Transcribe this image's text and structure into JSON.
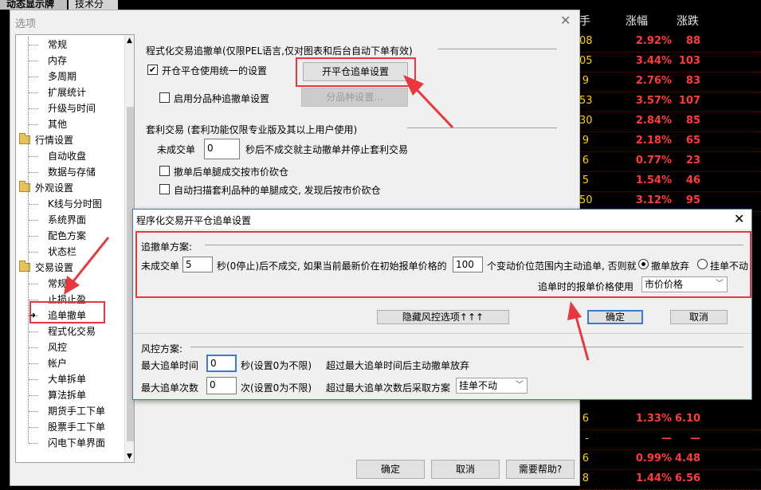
{
  "app": {
    "tabs": [
      "动态显示牌",
      "技术分析"
    ]
  },
  "quotes": {
    "headers": [
      "手",
      "涨幅",
      "涨跌"
    ],
    "rows": [
      {
        "a": "08",
        "pct": "2.92%",
        "chg": "88"
      },
      {
        "a": "05",
        "pct": "3.44%",
        "chg": "103"
      },
      {
        "a": "9",
        "pct": "2.76%",
        "chg": "83"
      },
      {
        "a": "53",
        "pct": "3.57%",
        "chg": "107"
      },
      {
        "a": "30",
        "pct": "2.84%",
        "chg": "85"
      },
      {
        "a": "9",
        "pct": "2.18%",
        "chg": "65"
      },
      {
        "a": "6",
        "pct": "0.77%",
        "chg": "23"
      },
      {
        "a": "5",
        "pct": "1.54%",
        "chg": "46"
      },
      {
        "a": "50",
        "pct": "3.12%",
        "chg": "95"
      }
    ],
    "bottom_rows": [
      {
        "a": "6",
        "pct": "1.33%",
        "chg": "6.10"
      },
      {
        "a": "-",
        "pct": "—",
        "chg": "—"
      },
      {
        "a": "6",
        "pct": "0.99%",
        "chg": "4.48"
      },
      {
        "a": "8",
        "pct": "1.44%",
        "chg": "6.56"
      }
    ]
  },
  "options": {
    "title": "选项",
    "tree": {
      "top_items": [
        "常规",
        "内存",
        "多周期",
        "扩展统计",
        "升级与时间",
        "其他"
      ],
      "groups": [
        {
          "label": "行情设置",
          "items": [
            "自动收盘",
            "数据与存储"
          ]
        },
        {
          "label": "外观设置",
          "items": [
            "K线与分时图",
            "系统界面",
            "配色方案",
            "状态栏"
          ]
        },
        {
          "label": "交易设置",
          "items": [
            "常规",
            "止损止盈",
            "追单撤单",
            "程式化交易",
            "风控",
            "帐户",
            "大单拆单",
            "算法拆单",
            "期货手工下单",
            "股票手工下单",
            "闪电下单界面"
          ]
        }
      ],
      "selected": "追单撤单"
    },
    "program_section": {
      "title": "程式化交易追撤单(仅限PEL语言,仅对图表和后台自动下单有效)",
      "unified_label": "开仓平仓使用统一的设置",
      "unified_checked": "✔",
      "open_close_button": "开平仓追单设置",
      "by_variety_label": "启用分品种追撤单设置",
      "by_variety_button": "分品种设置..."
    },
    "arb_section": {
      "title": "套利交易 (套利功能仅限专业版及其以上用户使用)",
      "unfilled_label": "未成交单",
      "unfilled_value": "0",
      "unfilled_suffix": "秒后不成交就主动撤单并停止套利交易",
      "cancel_market_label": "撤单后单腿成交按市价砍仓",
      "auto_scan_label": "自动扫描套利品种的单腿成交, 发现后按市价砍仓"
    },
    "buttons": {
      "ok": "确定",
      "cancel": "取消",
      "help": "需要帮助?"
    }
  },
  "dialog": {
    "title": "程序化交易开平仓追单设置",
    "chase_section": {
      "title": "追撤单方案:",
      "prefix": "未成交单",
      "seconds": "5",
      "mid": "秒(0停止)后不成交, 如果当前最新价在初始报单价格的",
      "ticks": "100",
      "suffix": "个变动价位范围内主动追单, 否则就",
      "radio_cancel": "撤单放弃",
      "radio_hang": "挂单不动",
      "price_label": "追单时的报单价格使用",
      "price_value": "市价价格"
    },
    "toggle_button": "隐藏风控选项↑↑↑",
    "ok": "确定",
    "cancel": "取消",
    "risk_section": {
      "title": "风控方案:",
      "max_time_label": "最大追单时间",
      "max_time_value": "0",
      "max_time_unit": "秒(设置0为不限)",
      "max_time_desc": "超过最大追单时间后主动撤单放弃",
      "max_count_label": "最大追单次数",
      "max_count_value": "0",
      "max_count_unit": "次(设置0为不限)",
      "max_count_desc": "超过最大追单次数后采取方案",
      "max_count_action": "挂单不动"
    }
  },
  "colors": {
    "annotation_red": "#e8383d",
    "quote_red": "#ff3b3b",
    "quote_yellow": "#ffd000"
  }
}
